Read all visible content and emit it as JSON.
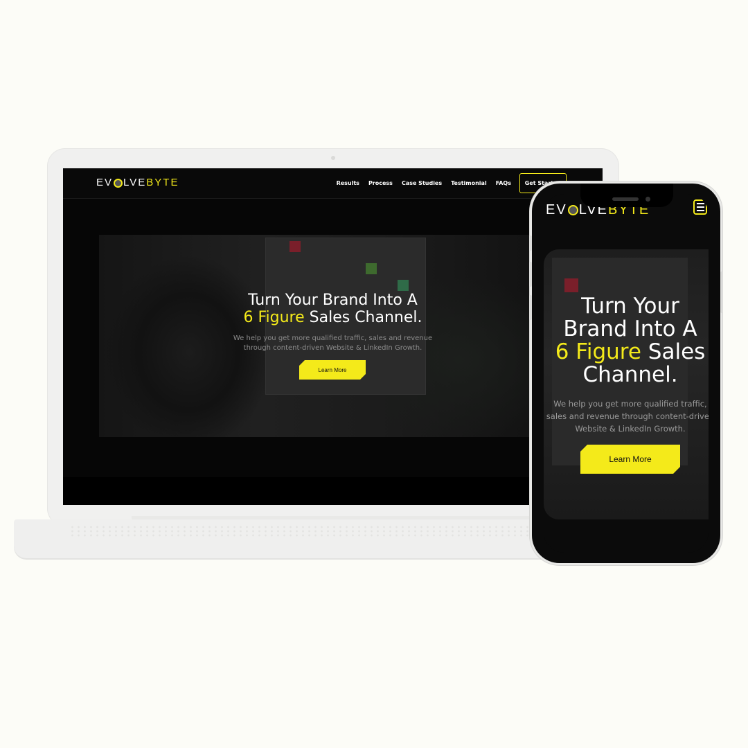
{
  "brand": {
    "logo_pre": "EV",
    "logo_mid": "LVE",
    "logo_accent": "BYTE",
    "accent_color": "#f4ea1a",
    "background_color": "#fcfcf7"
  },
  "nav": {
    "items": [
      "Results",
      "Process",
      "Case Studies",
      "Testimonial",
      "FAQs"
    ],
    "cta_label": "Get Started",
    "menu_icon": "hamburger-menu-icon"
  },
  "hero": {
    "desktop": {
      "headline_line1": "Turn Your Brand Into A",
      "headline_highlight": "6 Figure",
      "headline_rest": "Sales Channel.",
      "subtext_line1": "We help you get more qualified traffic, sales and revenue",
      "subtext_line2": "through content-driven Website & LinkedIn Growth."
    },
    "mobile": {
      "headline_line1": "Turn Your",
      "headline_line2": "Brand Into A",
      "headline_highlight": "6 Figure",
      "headline_rest": "Sales",
      "headline_line4": "Channel.",
      "subtext_line1": "We help you get more qualified traffic,",
      "subtext_line2": "sales and revenue through content-driven",
      "subtext_line3": "Website & LinkedIn Growth."
    },
    "button_label": "Learn More"
  }
}
